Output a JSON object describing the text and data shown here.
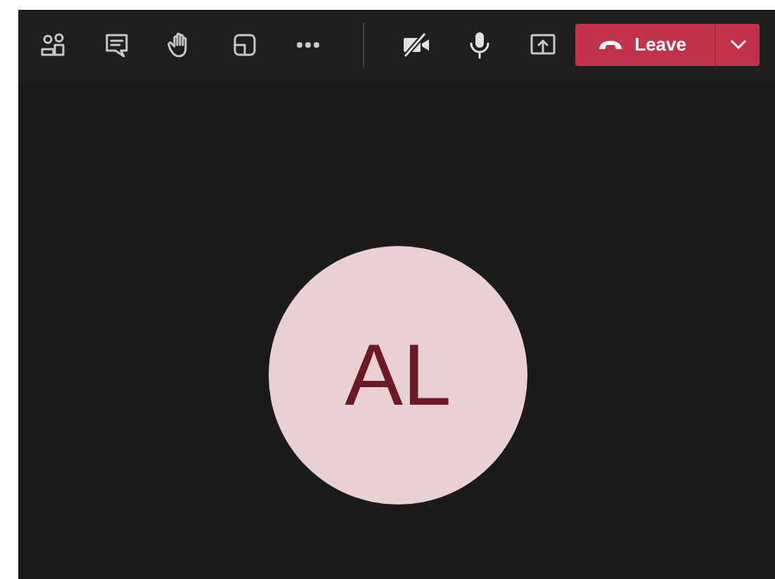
{
  "toolbar": {
    "items": [
      {
        "kind": "people"
      },
      {
        "kind": "chat"
      },
      {
        "kind": "hand"
      },
      {
        "kind": "rooms"
      },
      {
        "kind": "more"
      },
      {
        "kind": "divider"
      },
      {
        "kind": "camera",
        "on": false
      },
      {
        "kind": "mic",
        "on": true
      },
      {
        "kind": "share"
      }
    ],
    "leave_button": {
      "label": "Leave"
    }
  },
  "participant": {
    "initials": "AL"
  }
}
